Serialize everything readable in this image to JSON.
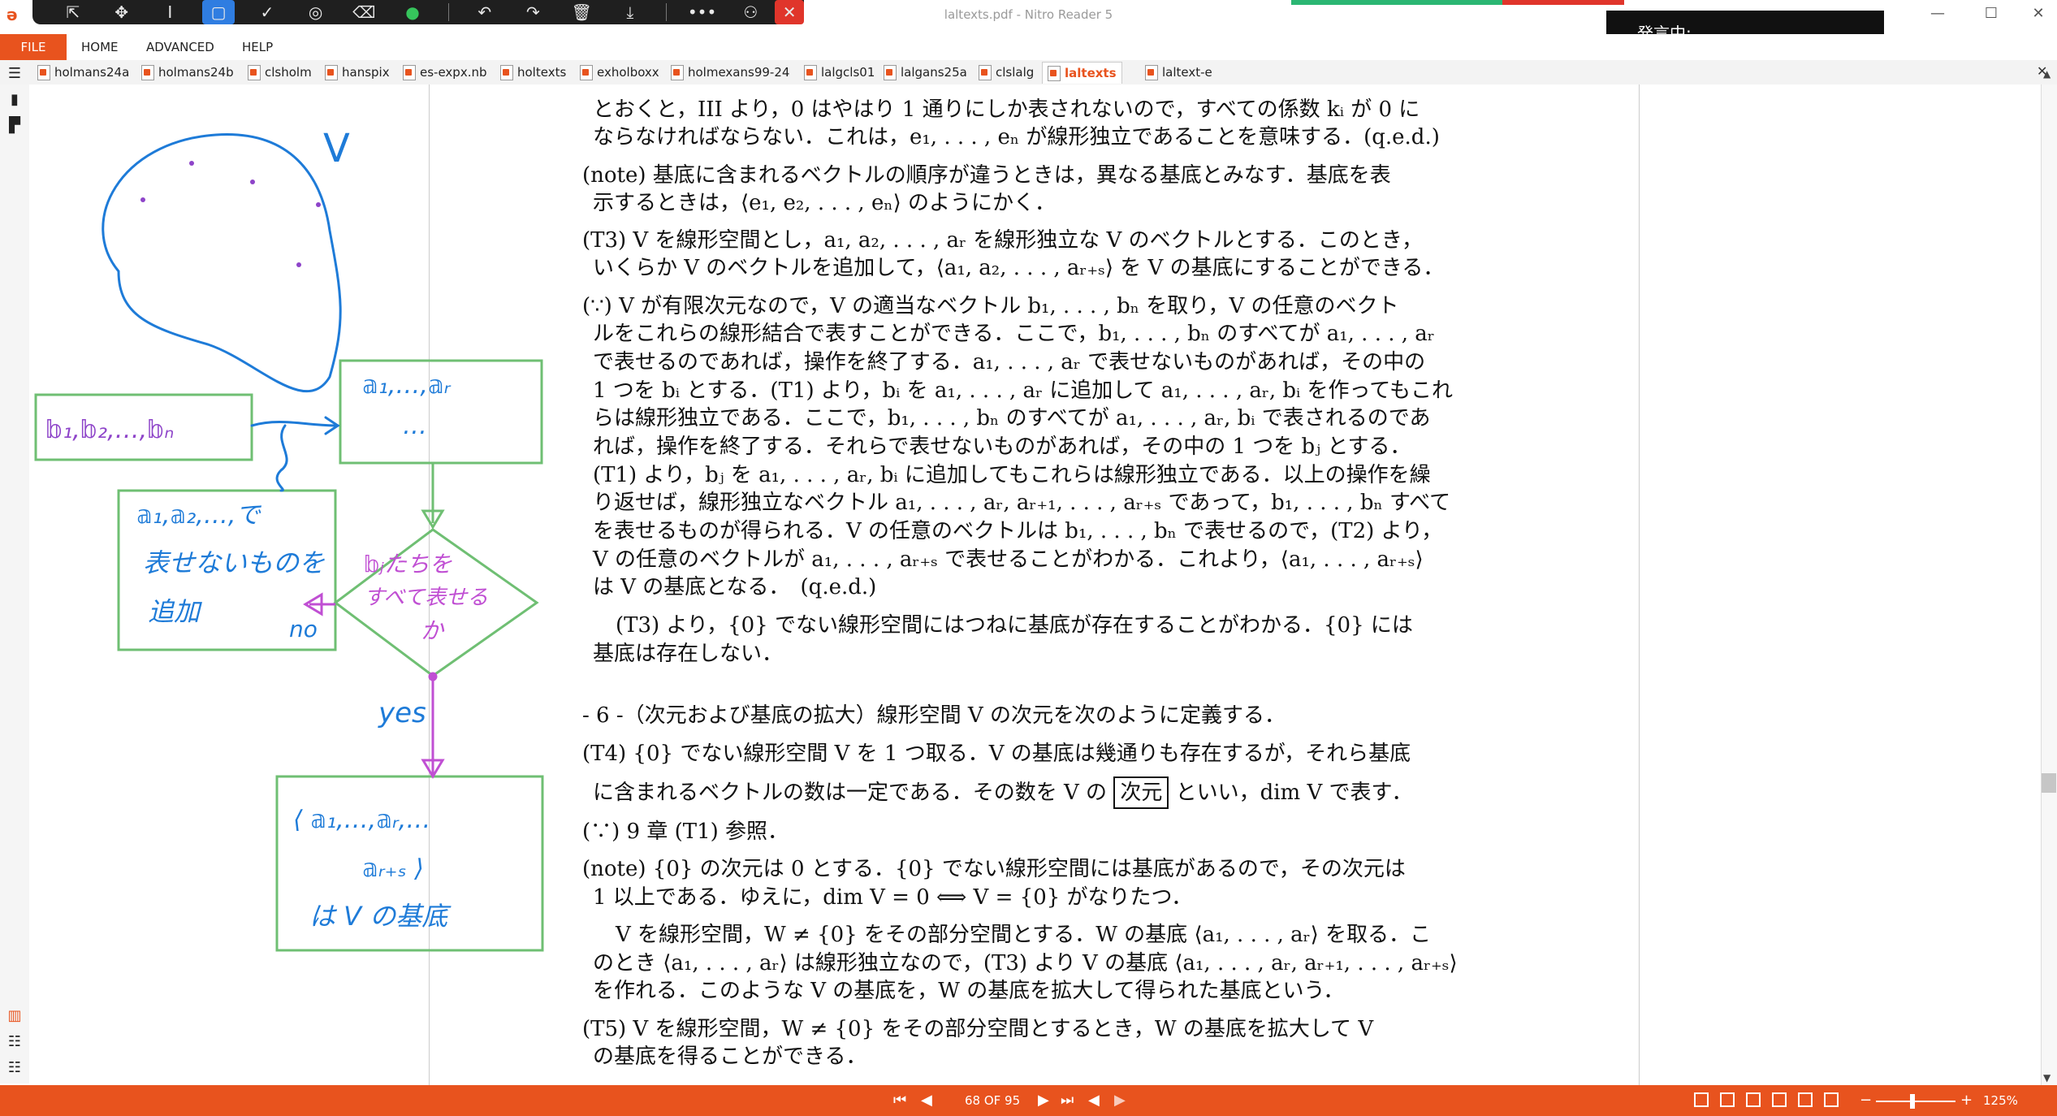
{
  "window": {
    "title": "laltexts.pdf - Nitro Reader 5",
    "speaking_label": "発言中:",
    "colors": {
      "accent": "#e8531e",
      "rec_green": "#2bb673",
      "rec_red": "#e0352b"
    }
  },
  "floating_toolbar": {
    "tools": [
      {
        "name": "pointer-icon",
        "glyph": "⇱"
      },
      {
        "name": "move-icon",
        "glyph": "✥"
      },
      {
        "name": "text-cursor-icon",
        "glyph": "I"
      },
      {
        "name": "rectangle-select-icon",
        "glyph": "▢"
      },
      {
        "name": "check-icon",
        "glyph": "✓"
      },
      {
        "name": "stamp-icon",
        "glyph": "◎"
      },
      {
        "name": "eraser-icon",
        "glyph": "⌫"
      },
      {
        "name": "color-dot-icon",
        "glyph": "●"
      },
      {
        "name": "undo-icon",
        "glyph": "↶"
      },
      {
        "name": "redo-icon",
        "glyph": "↷"
      },
      {
        "name": "trash-icon",
        "glyph": "🗑"
      },
      {
        "name": "download-icon",
        "glyph": "⤓"
      },
      {
        "name": "more-icon",
        "glyph": "•••"
      },
      {
        "name": "user-icon",
        "glyph": "⚇"
      },
      {
        "name": "close-icon",
        "glyph": "✕"
      }
    ]
  },
  "menu": {
    "file": "FILE",
    "items": [
      "HOME",
      "ADVANCED",
      "HELP"
    ]
  },
  "tabs": [
    "holmans24a",
    "holmans24b",
    "clsholm",
    "hanspix",
    "es-expx.nb",
    "holtexts",
    "exholboxx",
    "holmexans99-24",
    "lalgcls01",
    "lalgans25a",
    "clslalg",
    "laltexts",
    "laltext-e"
  ],
  "active_tab_index": 11,
  "status": {
    "page_indicator": "68 OF 95",
    "zoom": "125%",
    "nav": [
      "⏮",
      "◀",
      "▶",
      "⏭",
      "◀",
      "▶"
    ]
  },
  "annotation": {
    "space_label": "V",
    "box1_text": "𝕓₁,𝕓₂,…,𝕓ₙ",
    "box2_line1": "𝕒₁,…,𝕒ᵣ",
    "box2_line2": "…",
    "box3_line1": "𝕒₁,𝕒₂,…,で",
    "box3_line2": "表せないものを",
    "box3_line3": "追加",
    "diamond_line1": "𝕓ⱼたちを",
    "diamond_line2": "すべて表せる",
    "diamond_line3": "か",
    "no_label": "no",
    "yes_label": "yes",
    "box4_line1": "⟨ 𝕒₁,…,𝕒ᵣ,…",
    "box4_line2": "𝕒ᵣ₊ₛ ⟩",
    "box4_line3": "は V の基底"
  },
  "document": {
    "lines": [
      "とおくと，III より，0 はやはり 1 通りにしか表されないので，すべての係数 kᵢ が 0 に",
      "ならなければならない．これは，e₁, . . . , eₙ が線形独立であることを意味する．(q.e.d.)",
      "(note) 基底に含まれるベクトルの順序が違うときは，異なる基底とみなす．基底を表",
      "示するときは，⟨e₁, e₂, . . . , eₙ⟩ のようにかく．",
      "(T3) V を線形空間とし，a₁, a₂, . . . , aᵣ を線形独立な V のベクトルとする．このとき，",
      "いくらか V のベクトルを追加して，⟨a₁, a₂, . . . , aᵣ₊ₛ⟩ を V の基底にすることができる．",
      "(∵) V が有限次元なので，V の適当なベクトル b₁, . . . , bₙ を取り，V の任意のベクト",
      "ルをこれらの線形結合で表すことができる．ここで，b₁, . . . , bₙ のすべてが a₁, . . . , aᵣ",
      "で表せるのであれば，操作を終了する．a₁, . . . , aᵣ で表せないものがあれば，その中の",
      "1 つを bᵢ とする．(T1) より，bᵢ を a₁, . . . , aᵣ に追加して a₁, . . . , aᵣ, bᵢ を作ってもこれ",
      "らは線形独立である．ここで，b₁, . . . , bₙ のすべてが a₁, . . . , aᵣ, bᵢ で表されるのであ",
      "れば，操作を終了する．それらで表せないものがあれば，その中の 1 つを bⱼ とする．",
      "(T1) より，bⱼ を a₁, . . . , aᵣ, bᵢ に追加してもこれらは線形独立である．以上の操作を繰",
      "り返せば，線形独立なベクトル a₁, . . . , aᵣ, aᵣ₊₁, . . . , aᵣ₊ₛ であって，b₁, . . . , bₙ すべて",
      "を表せるものが得られる．V の任意のベクトルは b₁, . . . , bₙ で表せるので，(T2) より，",
      "V の任意のベクトルが a₁, . . . , aᵣ₊ₛ で表せることがわかる．これより，⟨a₁, . . . , aᵣ₊ₛ⟩",
      "は V の基底となる．　(q.e.d.)",
      "(T3) より，{0} でない線形空間にはつねに基底が存在することがわかる．{0} には",
      "基底は存在しない．",
      "- 6 -（次元および基底の拡大）線形空間 V の次元を次のように定義する．",
      "(T4) {0} でない線形空間 V を 1 つ取る．V の基底は幾通りも存在するが，それら基底",
      "(∵) 9 章 (T1) 参照．",
      "(note) {0} の次元は 0 とする．{0} でない線形空間には基底があるので，その次元は",
      "1 以上である．ゆえに，dim V = 0 ⟺ V = {0} がなりたつ．",
      "V を線形空間，W ≠ {0} をその部分空間とする．W の基底 ⟨a₁, . . . , aᵣ⟩ を取る．こ",
      "のとき ⟨a₁, . . . , aᵣ⟩ は線形独立なので，(T3) より V の基底 ⟨a₁, . . . , aᵣ, aᵣ₊₁, . . . , aᵣ₊ₛ⟩",
      "を作れる．このような V の基底を，W の基底を拡大して得られた基底という．",
      "(T5) V を線形空間，W ≠ {0} をその部分空間とするとき，W の基底を拡大して V",
      "の基底を得ることができる．"
    ],
    "t4_line2_pre": "に含まれるベクトルの数は一定である．その数を V の",
    "t4_boxed": "次元",
    "t4_line2_post": "といい，dim V で表す．"
  }
}
